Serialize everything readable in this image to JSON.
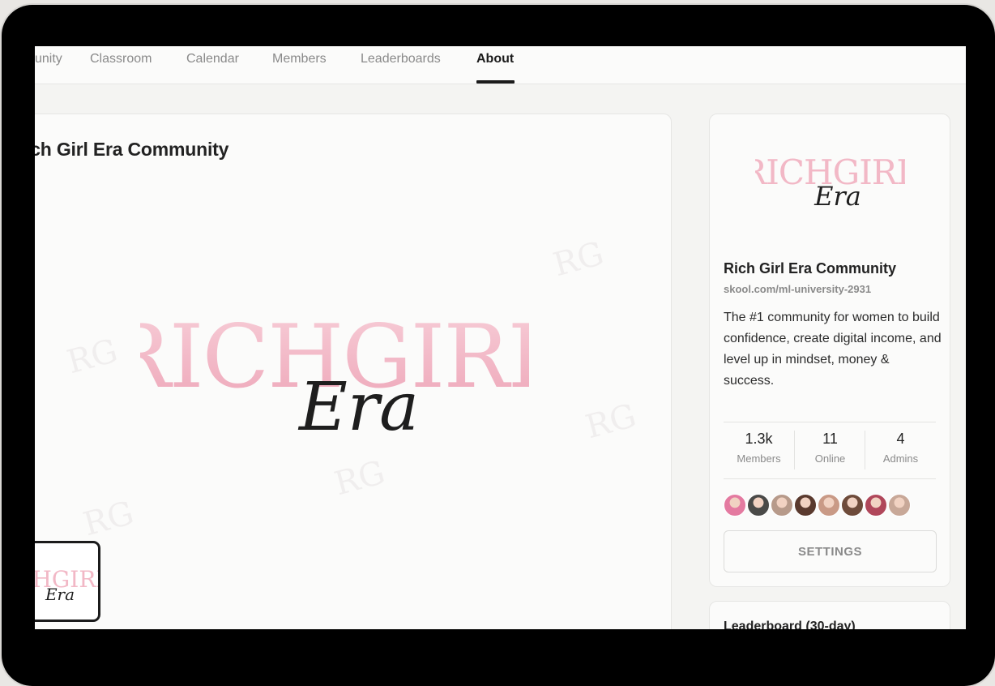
{
  "nav": {
    "items": [
      {
        "label": "unity"
      },
      {
        "label": "Classroom"
      },
      {
        "label": "Calendar"
      },
      {
        "label": "Members"
      },
      {
        "label": "Leaderboards"
      },
      {
        "label": "About"
      }
    ],
    "active": "About"
  },
  "main": {
    "title": "ich Girl Era Community",
    "logo_main": "RICHGIRL",
    "logo_script": "Era",
    "thumb_main": "ICHGIRL",
    "thumb_script": "Era",
    "watermark": "RG"
  },
  "sidebar": {
    "logo_main": "RICHGIRL",
    "logo_script": "Era",
    "name": "Rich Girl Era Community",
    "url": "skool.com/ml-university-2931",
    "description": "The #1 community for women to build confidence, create digital income, and level up in mindset, money & success.",
    "stats": [
      {
        "value": "1.3k",
        "label": "Members"
      },
      {
        "value": "11",
        "label": "Online"
      },
      {
        "value": "4",
        "label": "Admins"
      }
    ],
    "avatar_colors": [
      "#e47aa0",
      "#4a4a48",
      "#b79a8a",
      "#5a3a2e",
      "#c99a86",
      "#6e4b3a",
      "#b0475a",
      "#c8a898"
    ],
    "settings_label": "SETTINGS"
  },
  "leaderboard": {
    "title": "Leaderboard (30-day)"
  },
  "colors": {
    "logo_pink": "#f2b8c6",
    "script_black": "#1e1e1e",
    "accent": "#1b1b1b"
  }
}
